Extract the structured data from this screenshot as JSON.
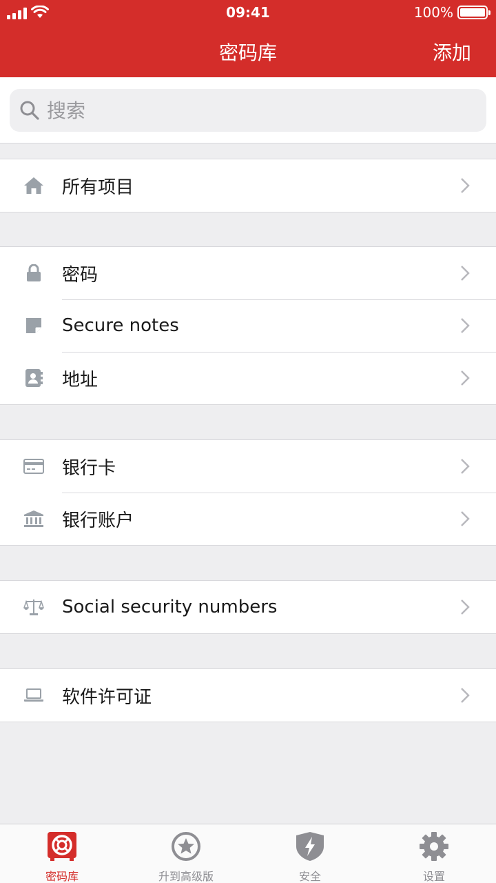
{
  "status_bar": {
    "time": "09:41",
    "battery": "100%",
    "battery_level": 1.0
  },
  "nav": {
    "title": "密码库",
    "add_label": "添加"
  },
  "search": {
    "placeholder": "搜索"
  },
  "groups": [
    [
      {
        "label": "所有项目",
        "icon": "home-icon"
      }
    ],
    [
      {
        "label": "密码",
        "icon": "lock-icon"
      },
      {
        "label": "Secure notes",
        "icon": "note-icon"
      },
      {
        "label": "地址",
        "icon": "contact-card-icon"
      }
    ],
    [
      {
        "label": "银行卡",
        "icon": "credit-card-icon"
      },
      {
        "label": "银行账户",
        "icon": "bank-icon"
      }
    ],
    [
      {
        "label": "Social security numbers",
        "icon": "scales-icon"
      }
    ],
    [
      {
        "label": "软件许可证",
        "icon": "laptop-icon"
      }
    ]
  ],
  "tabbar": {
    "tabs": [
      {
        "label": "密码库",
        "icon": "vault-icon",
        "active": true
      },
      {
        "label": "升到高级版",
        "icon": "star-badge-icon",
        "active": false
      },
      {
        "label": "安全",
        "icon": "shield-bolt-icon",
        "active": false
      },
      {
        "label": "设置",
        "icon": "gear-icon",
        "active": false
      }
    ]
  },
  "colors": {
    "brand": "#d42d2a",
    "icon_gray": "#9aa1a8",
    "background": "#eeeef0"
  }
}
